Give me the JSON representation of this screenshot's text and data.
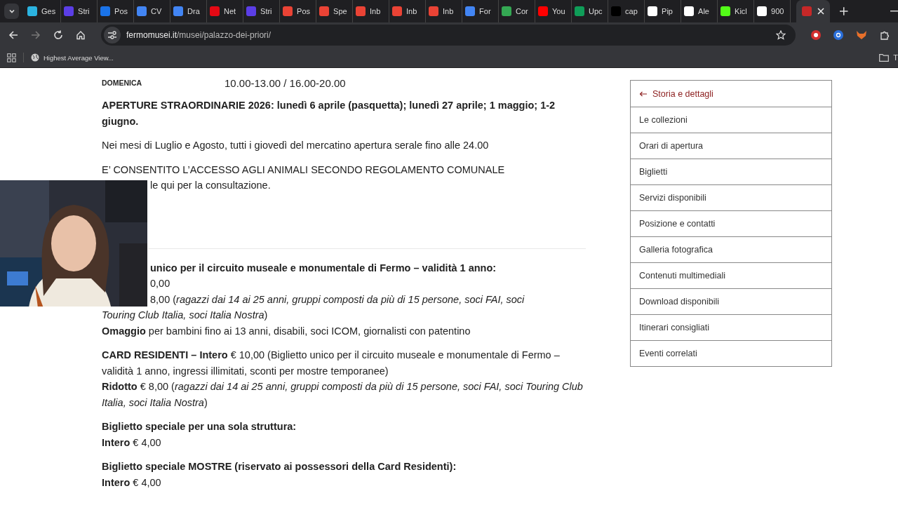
{
  "tabs": [
    {
      "title": "Ges",
      "color": "#2bb3e0",
      "selected": false
    },
    {
      "title": "Stri",
      "color": "#5b3ee6",
      "selected": false
    },
    {
      "title": "Pos",
      "color": "#1a73e8",
      "selected": false
    },
    {
      "title": "CV",
      "color": "#4285f4",
      "selected": false
    },
    {
      "title": "Dra",
      "color": "#4285f4",
      "selected": false
    },
    {
      "title": "Net",
      "color": "#e50914",
      "selected": false
    },
    {
      "title": "Stri",
      "color": "#5b3ee6",
      "selected": false
    },
    {
      "title": "Pos",
      "color": "#ea4335",
      "selected": false
    },
    {
      "title": "Spe",
      "color": "#ea4335",
      "selected": false
    },
    {
      "title": "Inb",
      "color": "#ea4335",
      "selected": false
    },
    {
      "title": "Inb",
      "color": "#ea4335",
      "selected": false
    },
    {
      "title": "Inb",
      "color": "#ea4335",
      "selected": false
    },
    {
      "title": "For",
      "color": "#4285f4",
      "selected": false
    },
    {
      "title": "Cor",
      "color": "#34a853",
      "selected": false
    },
    {
      "title": "You",
      "color": "#ff0000",
      "selected": false
    },
    {
      "title": "Upc",
      "color": "#0f9d58",
      "selected": false
    },
    {
      "title": "cap",
      "color": "#000000",
      "selected": false
    },
    {
      "title": "Pip",
      "color": "#ffffff",
      "selected": false
    },
    {
      "title": "Ale",
      "color": "#ffffff",
      "selected": false
    },
    {
      "title": "Kicl",
      "color": "#53fc18",
      "selected": false
    },
    {
      "title": "900",
      "color": "#ffffff",
      "selected": false
    },
    {
      "color": "#c62828",
      "selected": true
    }
  ],
  "address": {
    "domain": "fermomusei.it",
    "path": "/musei/palazzo-dei-priori/"
  },
  "bookmarks": [
    {
      "label": "Highest Average View...",
      "kind": "site"
    },
    {
      "label": "T",
      "kind": "folder"
    }
  ],
  "hours": [
    {
      "day": "DOMENICA",
      "time": "10.00-13.00 / 16.00-20.00"
    }
  ],
  "paragraphs": [
    {
      "kind": "bold",
      "lines": [
        {
          "text": "APERTURE STRAORDINARIE 2026: lunedì 6 aprile (pasquetta); lunedì 27 aprile; 1 maggio; 1-2 giugno.",
          "covered": false
        }
      ]
    },
    {
      "kind": "text",
      "lines": [
        {
          "text": "Nei mesi di Luglio e Agosto, tutti i giovedì del mercatino apertura serale fino alle 24.00",
          "covered": false
        }
      ]
    },
    {
      "kind": "text",
      "lines": [
        {
          "text": "E’ CONSENTITO L’ACCESSO AGLI ANIMALI SECONDO REGOLAMENTO COMUNALE",
          "covered": false
        },
        {
          "text": "le qui per la consultazione.",
          "covered": true
        }
      ]
    },
    {
      "kind": "divider"
    },
    {
      "kind": "text",
      "lines": [
        {
          "text": "**unico per il circuito museale e monumentale di Fermo – validità 1 anno:**",
          "covered": true
        },
        {
          "text": "0,00",
          "covered": true
        },
        {
          "text": "8,00 (*ragazzi dai 14 ai 25 anni, gruppi composti da più di 15 persone, soci FAI, soci*",
          "covered": true
        },
        {
          "text": "*Touring Club Italia, soci Italia Nostra*)",
          "covered": false
        },
        {
          "text": "**Omaggio** per bambini fino ai 13 anni, disabili, soci ICOM, giornalisti con patentino",
          "covered": false
        }
      ]
    },
    {
      "kind": "text",
      "lines": [
        {
          "text": "**CARD RESIDENTI – Intero** € 10,00 (Biglietto unico per il circuito museale e monumentale di Fermo – validità 1 anno, ingressi illimitati, sconti per mostre temporanee)",
          "covered": false
        },
        {
          "text": "**Ridotto** € 8,00 (*ragazzi dai 14 ai 25 anni, gruppi composti da più di 15 persone, soci FAI, soci Touring Club Italia, soci Italia Nostra*)",
          "covered": false
        }
      ]
    },
    {
      "kind": "text",
      "lines": [
        {
          "text": "**Biglietto speciale per una sola struttura:**",
          "covered": false
        },
        {
          "text": "**Intero** € 4,00",
          "covered": false
        }
      ]
    },
    {
      "kind": "text",
      "lines": [
        {
          "text": "**Biglietto speciale MOSTRE (riservato ai possessori della Card Residenti):**",
          "covered": false
        },
        {
          "text": "**Intero** € 4,00",
          "covered": false
        }
      ]
    }
  ],
  "sidebar": {
    "items": [
      {
        "label": "Storia e dettagli",
        "kind": "back"
      },
      {
        "label": "Le collezioni",
        "kind": "link"
      },
      {
        "label": "Orari di apertura",
        "kind": "link"
      },
      {
        "label": "Biglietti",
        "kind": "link"
      },
      {
        "label": "Servizi disponibili",
        "kind": "link"
      },
      {
        "label": "Posizione e contatti",
        "kind": "link"
      },
      {
        "label": "Galleria fotografica",
        "kind": "link"
      },
      {
        "label": "Contenuti multimediali",
        "kind": "link"
      },
      {
        "label": "Download disponibili",
        "kind": "link"
      },
      {
        "label": "Itinerari consigliati",
        "kind": "link"
      },
      {
        "label": "Eventi correlati",
        "kind": "link"
      }
    ]
  }
}
